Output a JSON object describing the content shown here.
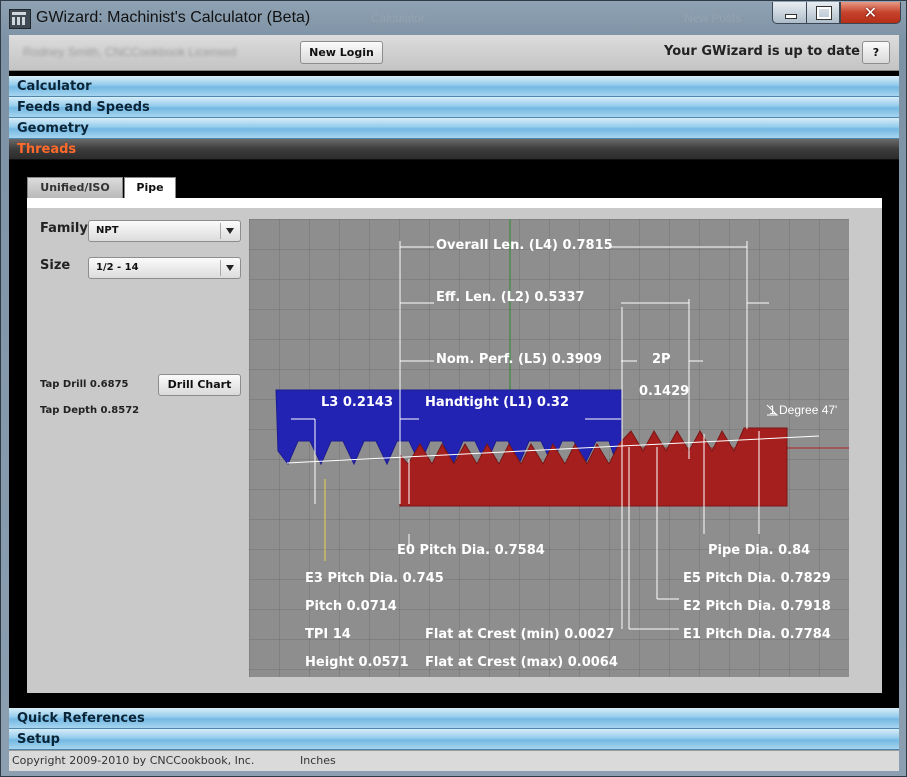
{
  "window": {
    "title": "GWizard: Machinist's Calculator (Beta)",
    "ghost_tab_1": "Calculator",
    "ghost_tab_2": "New Posts",
    "close_glyph": "✕"
  },
  "topbar": {
    "blurred_account": "Rodney Smith, CNCCookbook Licensed",
    "new_login_label": "New Login",
    "status_text": "Your GWizard is up to date",
    "help_label": "?"
  },
  "sections": {
    "calculator": "Calculator",
    "feeds": "Feeds and Speeds",
    "geometry": "Geometry",
    "threads": "Threads",
    "quick_references": "Quick References",
    "setup": "Setup"
  },
  "tabs": {
    "unified": "Unified/ISO",
    "pipe": "Pipe"
  },
  "form": {
    "family_label": "Family",
    "family_value": "NPT",
    "size_label": "Size",
    "size_value": "1/2 - 14",
    "tap_drill": "Tap Drill 0.6875",
    "tap_depth": "Tap Depth 0.8572",
    "drill_chart_label": "Drill Chart"
  },
  "diagram": {
    "overall_len": "Overall Len. (L4) 0.7815",
    "eff_len": "Eff. Len. (L2) 0.5337",
    "nom_perf": "Nom. Perf. (L5) 0.3909",
    "two_p": "2P",
    "two_p_value": "0.1429",
    "l3": "L3 0.2143",
    "handtight": "Handtight (L1) 0.32",
    "degree": "1 Degree 47'",
    "e0": "E0 Pitch Dia. 0.7584",
    "pipe_dia": "Pipe Dia. 0.84",
    "e3": "E3 Pitch Dia. 0.745",
    "e5": "E5 Pitch Dia. 0.7829",
    "pitch": "Pitch 0.0714",
    "e2": "E2 Pitch Dia. 0.7918",
    "tpi": "TPI 14",
    "flat_min": "Flat at Crest (min) 0.0027",
    "e1": "E1 Pitch Dia. 0.7784",
    "height": "Height 0.0571",
    "flat_max": "Flat at Crest (max) 0.0064",
    "colors": {
      "male": "#2323b3",
      "female": "#a51f1f",
      "background": "#8e8e8e"
    }
  },
  "footer": {
    "copyright": "Copyright 2009-2010 by CNCCookbook, Inc.",
    "units": "Inches"
  }
}
